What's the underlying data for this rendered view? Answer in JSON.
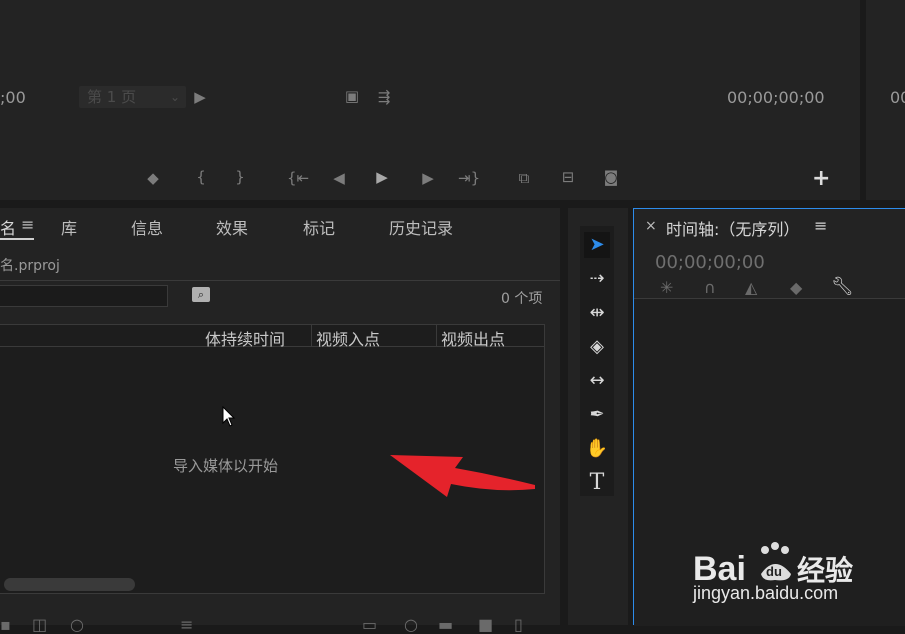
{
  "source_monitor": {
    "timecode_left": ";00",
    "page_select": "第 1 页",
    "timecode_right": "00;00;00;00",
    "timecode_far_right": "00"
  },
  "project_panel": {
    "tabs": [
      {
        "label": "名"
      },
      {
        "label": "库"
      },
      {
        "label": "信息"
      },
      {
        "label": "效果"
      },
      {
        "label": "标记"
      },
      {
        "label": "历史记录"
      }
    ],
    "menu_glyph": "≡",
    "project_file": "名.prproj",
    "item_count": "0 个项",
    "columns": [
      "体持续时间",
      "视频入点",
      "视频出点"
    ],
    "empty_message": "导入媒体以开始"
  },
  "timeline_panel": {
    "close_glyph": "×",
    "title": "时间轴:（无序列）",
    "menu_glyph": "≡",
    "timecode": "00;00;00;00"
  },
  "watermark": {
    "brand": "Bai du 经验",
    "url": "jingyan.baidu.com"
  },
  "colors": {
    "accent": "#2d8ceb",
    "arrow": "#e5232b",
    "panel_bg": "#232323"
  }
}
